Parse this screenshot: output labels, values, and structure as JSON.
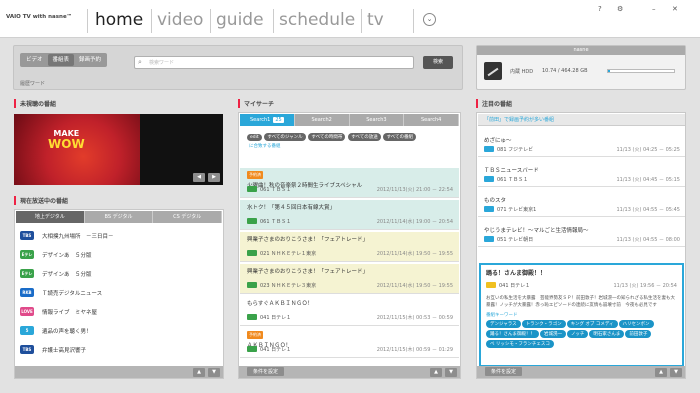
{
  "app": {
    "brand": "VAIO TV with nasne™",
    "nav": [
      "home",
      "video",
      "guide",
      "schedule",
      "tv"
    ],
    "active_nav": "home",
    "help_icon": "?",
    "toolbar_icons": [
      "help-icon",
      "settings-icon",
      "minimize-icon",
      "close-icon"
    ]
  },
  "search": {
    "tabs": [
      "ビデオ",
      "番組表",
      "録画予約"
    ],
    "selected_tab": "番組表",
    "placeholder": "検索ワード",
    "button": "検索",
    "keyword_label": "履歴ワード"
  },
  "device": {
    "title": "nasne",
    "hdd_label": "内蔵 HDD",
    "hdd_text": "10.74 / 464.28 GB",
    "hdd_fraction": 0.023
  },
  "unwatched": {
    "title": "未視聴の番組",
    "thumb_line1": "MAKE",
    "thumb_line2": "WOW"
  },
  "now_airing": {
    "title": "現在放送中の番組",
    "tabs": [
      "地上デジタル",
      "BS デジタル",
      "CS デジタル"
    ],
    "selected_tab": "地上デジタル",
    "rows": [
      {
        "channel": "TBS",
        "title": "大相撲九州場所　－三日目－",
        "color": "#1f4f9c"
      },
      {
        "channel": "Eテレ",
        "title": "デザインあ　５分版",
        "color": "#3aa24a"
      },
      {
        "channel": "Eテレ",
        "title": "デザインあ　５分版",
        "color": "#3aa24a"
      },
      {
        "channel": "RKB",
        "title": "Ｔ読売デジタルニュース",
        "color": "#1a6cc8"
      },
      {
        "channel": "LOVE",
        "title": "情報ライブ　ミヤネ屋",
        "color": "#e04a8a"
      },
      {
        "channel": "5",
        "title": "遺品の声を聴く男！",
        "color": "#2aa7d9"
      },
      {
        "channel": "TBS",
        "title": "弁護士高見沢響子",
        "color": "#1f4f9c"
      }
    ]
  },
  "my_search": {
    "title": "マイサーチ",
    "tabs": [
      "Search1",
      "Search2",
      "Search3",
      "Search4"
    ],
    "selected_tab": "Search1",
    "result_count": "25",
    "chips": [
      "edit",
      "すべてのジャンル",
      "すべての時間帯",
      "すべての放送",
      "すべての番組"
    ],
    "chip_link": "に合致する番組",
    "results": [
      {
        "badge": "予約済",
        "title": "火曜曲！秋の音楽祭２時間生ライブスペシャル",
        "ch": "061 ＴＢＳ１",
        "date": "2012/11/13(火)  21:00 － 22:54",
        "style": "teal"
      },
      {
        "badge": "",
        "title": "水トク！「第４５回日本有線大賞」",
        "ch": "061 ＴＢＳ１",
        "date": "2012/11/14(水)  19:00 － 20:54",
        "style": "teal"
      },
      {
        "badge": "",
        "title": "興業子さまのおりこうさま！「フェアトレード」",
        "ch": "021 ＮＨＫＥテレ１東京",
        "date": "2012/11/14(水)  19:50 － 19:55",
        "style": "yel"
      },
      {
        "badge": "",
        "title": "興業子さまのおりこうさま！「フェアトレード」",
        "ch": "023 ＮＨＫＥテレ３東京",
        "date": "2012/11/14(水)  19:50 － 19:55",
        "style": "yel"
      },
      {
        "badge": "",
        "title": "もらすぐＡＫＢＩＮＧＯ！",
        "ch": "041 日テレ１",
        "date": "2012/11/15(木)  00:53 － 00:59",
        "style": ""
      },
      {
        "badge": "予約済",
        "title": "ＡＫＢＩＮＧＯ！",
        "ch": "041 日テレ１",
        "date": "2012/11/15(木)  00:59 － 01:29",
        "style": ""
      }
    ],
    "footer_button": "条件を設定"
  },
  "featured": {
    "title": "注目の番組",
    "header": "「前田」で録画予約が多い番組",
    "rows": [
      {
        "title": "めざにゅ～",
        "ch": "081 フジテレビ",
        "date": "11/13 (火)  04:25 － 05:25"
      },
      {
        "title": "ＴＢＳニュースバード",
        "ch": "061 ＴＢＳ１",
        "date": "11/13 (火)  04:45 － 05:15"
      },
      {
        "title": "ものスタ",
        "ch": "071 テレビ東京1",
        "date": "11/13 (火)  04:55 － 05:45"
      },
      {
        "title": "やじうまテレビ！～マルごと生活情報局～",
        "ch": "051 テレビ朝日",
        "date": "11/13 (火)  04:55 － 08:00"
      }
    ],
    "detail": {
      "title": "踊る！さんま御殿！！",
      "ch": "041 日テレ１",
      "date": "11/13 (火)  19:56 － 20:54",
      "desc": "お互いの私生活を大暴露　芸能界勢友ＳＰ！前田敦子！岩城滉一の知られざる私生活を妻も大暴露！ノッチが大暴露！赤っ恥エピソードの連続に友情も崩壊寸前　今夜も必見です",
      "kw_label": "番組キーワード",
      "keywords": [
        "デンジャラス",
        "トランク・ラゴン",
        "キング オブ コメディ",
        "ハリセンボン",
        "踊る！さんま御殿！！",
        "岩城滉一",
        "ノッチ",
        "明石家さんま",
        "前田敦子",
        "ベ リッシモ・フランチェスコ"
      ]
    },
    "footer_button": "条件を設定"
  },
  "footer_arrows": [
    "◀",
    "▲",
    "▼"
  ]
}
